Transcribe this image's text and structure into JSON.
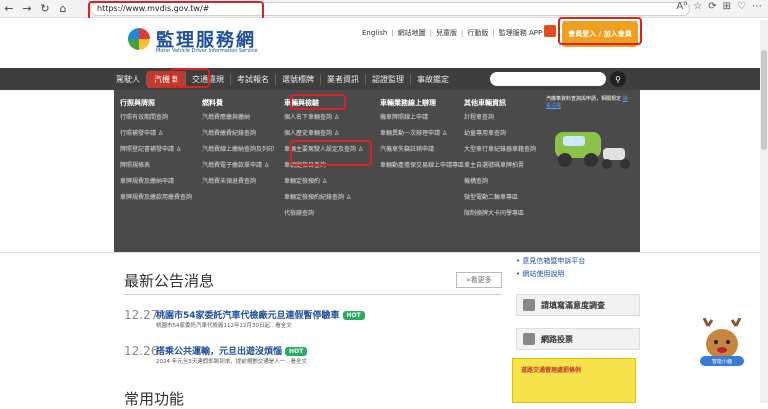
{
  "browser": {
    "url": "https://www.mvdis.gov.tw/#",
    "back": "←",
    "forward": "→",
    "reload": "↻",
    "home": "⌂",
    "actions": [
      "A⁰",
      "☆",
      "⟳",
      "⊞",
      "♡",
      "⋯"
    ]
  },
  "header": {
    "logo_text": "監理服務網",
    "logo_subtitle": "Motor Vehicle Driver Information Service",
    "links": [
      "English",
      "網站地圖",
      "兒童版",
      "行動版",
      "監理服務 APP"
    ],
    "login": "會員登入 / 加入會員"
  },
  "nav": {
    "items": [
      "駕駛人",
      "汽機車",
      "交通違規",
      "考試報名",
      "選號標牌",
      "業者資訊",
      "認證監理",
      "事故鑑定"
    ],
    "active": "汽機車"
  },
  "mega": {
    "columns": [
      {
        "head": "行照與牌照",
        "items": [
          "行照有效期間查詢",
          "行照補發申請 ♙",
          "牌照登記書補發申請 ♙",
          "牌照規格表",
          "車牌規費及繳納申請",
          "車牌規費及繳款用繳費查詢"
        ]
      },
      {
        "head": "燃料費",
        "items": [
          "汽燃費應繳與繳納",
          "汽燃費繳費紀錄查詢",
          "汽燃費線上繳納查詢及列印",
          "汽燃費電子繳款單申請 ♙",
          "汽燃費未領退費查詢"
        ]
      },
      {
        "head": "車輛與檢驗",
        "items": [
          "個人名下車輛查詢 ♙",
          "個人歷史車輛查詢 ♙",
          "車輛主要駕駛人設定及查詢 ♙",
          "車輛定檢日查詢",
          "車輛定檢預約 ♙",
          "車輛定檢預約紀錄查詢 ♙",
          "代檢廠查詢"
        ]
      },
      {
        "head": "車輛業務線上辦理",
        "items": [
          "機車牌照線上申請",
          "車輛異動一次辦理申請 ♙",
          "汽機車失竊註銷申請",
          "車輛動產擔保交易線上申請專區"
        ]
      },
      {
        "head": "其他車輛資訊",
        "items": [
          "計程車查詢",
          "幼童專用車查詢",
          "大型車行車紀錄器車籍查詢",
          "車主自選號碼車牌拍賣",
          "機構查詢",
          "微型電動二輪車專區",
          "限制換牌大卡同學專區"
        ]
      }
    ],
    "promo": "汽機車資料查詢與申請，相關規定 ",
    "promo_link": "請看這裡"
  },
  "sidebar": {
    "links": [
      "意見信箱暨申訴平台",
      "網站使用說明"
    ],
    "survey": "請填寫滿意度調查",
    "vote": "網路投票",
    "banner": "道路交通管理處罰條例"
  },
  "news": {
    "title": "最新公告消息",
    "more": "»看更多",
    "items": [
      {
        "date": "12.27",
        "head": "桃園市54家委託汽車代檢廠元旦連假暫停驗車",
        "hot": "HOT",
        "desc": "桃園市54家委託汽車代檢廠112年12月30日起...看全文"
      },
      {
        "date": "12.26",
        "head": "搭乘公共運輸，元旦出遊沒煩惱",
        "hot": "HOT",
        "desc": "2024 年元旦3天連假即將到來，提前規劃交通是人一...看全文"
      }
    ]
  },
  "common": {
    "title": "常用功能"
  },
  "mascot": {
    "label": "智能小鹿"
  },
  "colors": {
    "nav": "#3e3e3e",
    "mega": "#4a4a4a",
    "login": "#f0a020",
    "accent_red": "#c0392b",
    "hot": "#27ae60",
    "link": "#1f4fa0"
  }
}
